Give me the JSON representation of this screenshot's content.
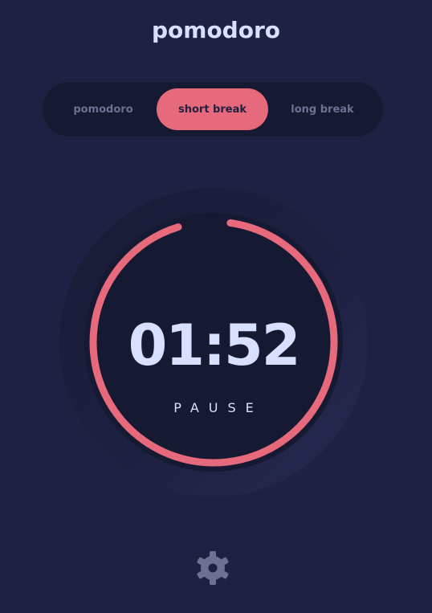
{
  "app": {
    "title": "pomodoro"
  },
  "modes": {
    "items": [
      {
        "label": "pomodoro"
      },
      {
        "label": "short break"
      },
      {
        "label": "long break"
      }
    ],
    "active": "short break"
  },
  "timer": {
    "time": "01:52",
    "action_label": "PAUSE",
    "progress_fraction": 0.93
  },
  "settings": {
    "icon": "gear-icon"
  },
  "colors": {
    "background": "#1f2142",
    "panel": "#161932",
    "accent": "#e7697c",
    "text": "#d7e0ff",
    "muted": "#6c7192"
  }
}
